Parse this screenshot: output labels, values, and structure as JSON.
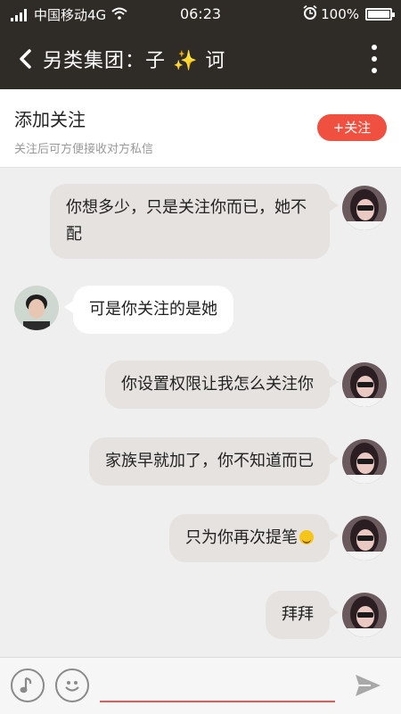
{
  "status_bar": {
    "carrier": "中国移动4G",
    "time": "06:23",
    "battery": "100%",
    "battery_level": 1.0,
    "icons": [
      "signal-icon",
      "wifi-icon",
      "alarm-icon",
      "battery-icon"
    ]
  },
  "header": {
    "title": "另类集团：子 ✨ 诃",
    "icons": [
      "back-arrow-icon",
      "more-vertical-icon"
    ]
  },
  "follow_panel": {
    "title": "添加关注",
    "subtitle": "关注后可方便接收对方私信",
    "button_label": "+关注"
  },
  "messages": [
    {
      "side": "right",
      "text": "你想多少，只是关注你而已，她不配"
    },
    {
      "side": "left",
      "text": "可是你关注的是她"
    },
    {
      "side": "right",
      "text": "你设置权限让我怎么关注你"
    },
    {
      "side": "right",
      "text": "家族早就加了，你不知道而已"
    },
    {
      "side": "right",
      "text": "只为你再次提笔",
      "emoji": "smile-emoji"
    },
    {
      "side": "right",
      "text": "拜拜"
    }
  ],
  "input_bar": {
    "value": "",
    "icons": [
      "music-note-icon",
      "smiley-icon",
      "send-icon"
    ]
  },
  "colors": {
    "header_bg": "#2f2b27",
    "accent": "#f0503f",
    "bubble_right": "#e6e2df",
    "bubble_left": "#ffffff",
    "chat_bg": "#efefef"
  }
}
